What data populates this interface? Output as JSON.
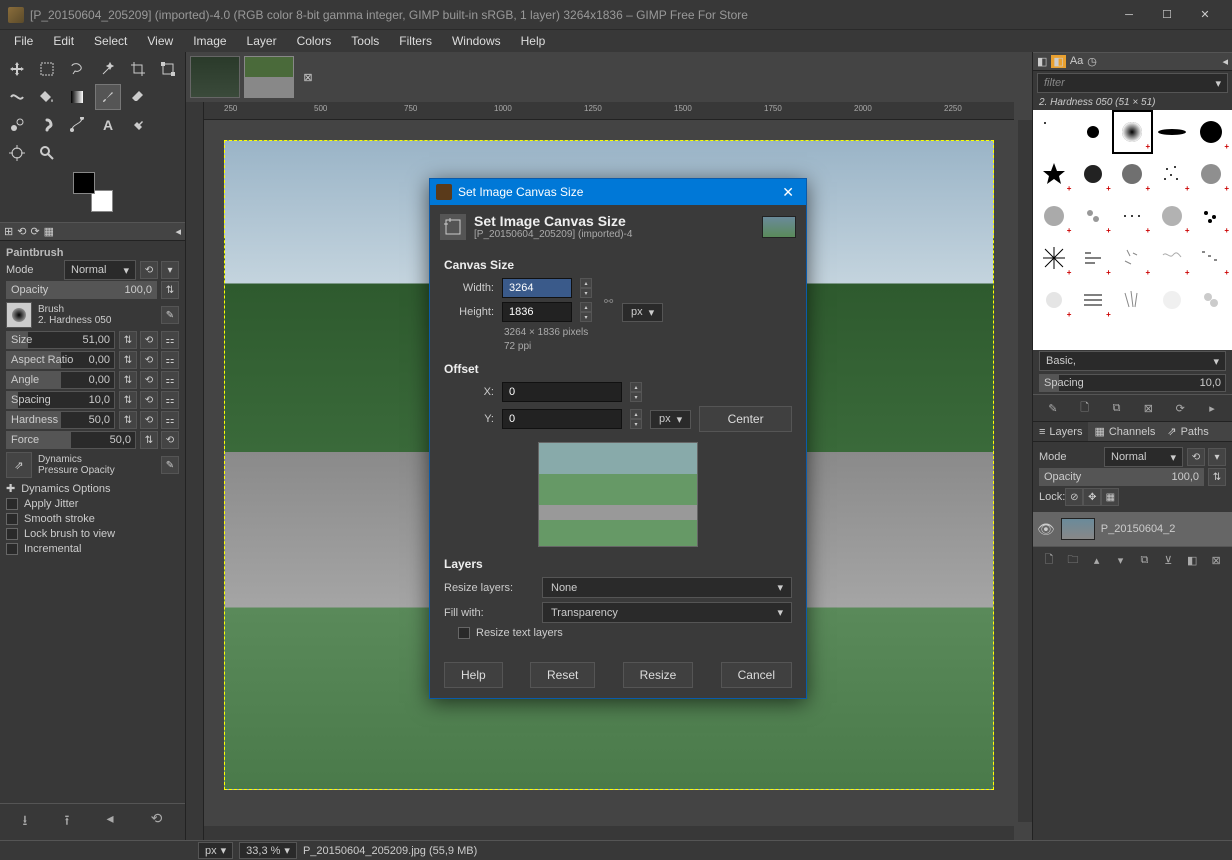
{
  "window": {
    "title": "[P_20150604_205209] (imported)-4.0 (RGB color 8-bit gamma integer, GIMP built-in sRGB, 1 layer) 3264x1836 – GIMP Free For Store"
  },
  "menu": [
    "File",
    "Edit",
    "Select",
    "View",
    "Image",
    "Layer",
    "Colors",
    "Tools",
    "Filters",
    "Windows",
    "Help"
  ],
  "toolOptions": {
    "title": "Paintbrush",
    "modeLabel": "Mode",
    "modeValue": "Normal",
    "opacityLabel": "Opacity",
    "opacityValue": "100,0",
    "brushLabel": "Brush",
    "brushName": "2. Hardness 050",
    "size": {
      "label": "Size",
      "value": "51,00"
    },
    "aspect": {
      "label": "Aspect Ratio",
      "value": "0,00"
    },
    "angle": {
      "label": "Angle",
      "value": "0,00"
    },
    "spacing": {
      "label": "Spacing",
      "value": "10,0"
    },
    "hardness": {
      "label": "Hardness",
      "value": "50,0"
    },
    "force": {
      "label": "Force",
      "value": "50,0"
    },
    "dynamicsLabel": "Dynamics",
    "dynamicsValue": "Pressure Opacity",
    "dynOptions": "Dynamics Options",
    "jitter": "Apply Jitter",
    "smooth": "Smooth stroke",
    "lockBrush": "Lock brush to view",
    "incremental": "Incremental"
  },
  "dialog": {
    "titlebar": "Set Image Canvas Size",
    "header": "Set Image Canvas Size",
    "subheader": "[P_20150604_205209] (imported)-4",
    "canvasSize": "Canvas Size",
    "widthLabel": "Width:",
    "widthValue": "3264",
    "heightLabel": "Height:",
    "heightValue": "1836",
    "unit": "px",
    "pxInfo": "3264 × 1836 pixels",
    "ppiInfo": "72 ppi",
    "offset": "Offset",
    "xLabel": "X:",
    "xValue": "0",
    "yLabel": "Y:",
    "yValue": "0",
    "center": "Center",
    "layers": "Layers",
    "resizeLayers": "Resize layers:",
    "resizeValue": "None",
    "fillWith": "Fill with:",
    "fillValue": "Transparency",
    "resizeText": "Resize text layers",
    "help": "Help",
    "reset": "Reset",
    "resize": "Resize",
    "cancel": "Cancel"
  },
  "right": {
    "filterPlaceholder": "filter",
    "brushName": "2. Hardness 050 (51 × 51)",
    "basic": "Basic,",
    "spacing": "Spacing",
    "spacingValue": "10,0",
    "tabs": {
      "layers": "Layers",
      "channels": "Channels",
      "paths": "Paths"
    },
    "layerMode": "Mode",
    "layerModeValue": "Normal",
    "layerOpacity": "Opacity",
    "layerOpacityValue": "100,0",
    "lock": "Lock:",
    "layerName": "P_20150604_2"
  },
  "status": {
    "unit": "px",
    "zoom": "33,3 %",
    "file": "P_20150604_205209.jpg (55,9 MB)"
  },
  "ruler": [
    "250",
    "500",
    "750",
    "1000",
    "1250",
    "1500",
    "1750",
    "2000",
    "2250"
  ]
}
